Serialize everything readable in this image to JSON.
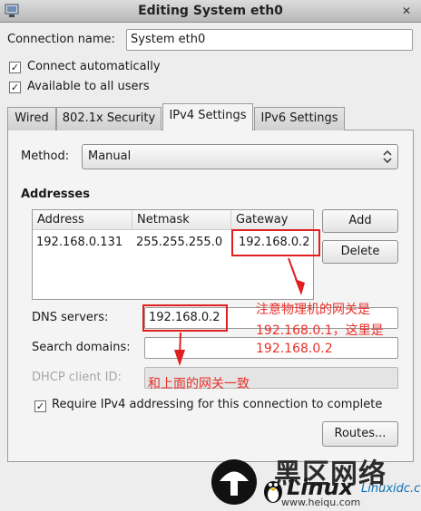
{
  "window": {
    "title": "Editing System eth0",
    "close_glyph": "✕"
  },
  "connection_name": {
    "label": "Connection name:",
    "value": "System eth0"
  },
  "checkboxes": {
    "auto_connect": {
      "label": "Connect automatically",
      "checked": true
    },
    "all_users": {
      "label": "Available to all users",
      "checked": true
    }
  },
  "tabs": [
    {
      "label": "Wired",
      "active": false
    },
    {
      "label": "802.1x Security",
      "active": false
    },
    {
      "label": "IPv4 Settings",
      "active": true
    },
    {
      "label": "IPv6 Settings",
      "active": false
    }
  ],
  "ipv4": {
    "method_label": "Method:",
    "method_value": "Manual",
    "addresses_heading": "Addresses",
    "columns": [
      "Address",
      "Netmask",
      "Gateway"
    ],
    "rows": [
      {
        "address": "192.168.0.131",
        "netmask": "255.255.255.0",
        "gateway": "192.168.0.2"
      }
    ],
    "add_button": "Add",
    "delete_button": "Delete",
    "dns_label": "DNS servers:",
    "dns_value": "192.168.0.2",
    "search_label": "Search domains:",
    "search_value": "",
    "dhcp_label": "DHCP client ID:",
    "dhcp_value": "",
    "require_label": "Require IPv4 addressing for this connection to complete",
    "require_checked": true,
    "routes_button": "Routes..."
  },
  "annotations": {
    "note_line1": "注意物理机的网关是",
    "note_line2": "192.168.0.1，这里是",
    "note_line3": "192.168.0.2",
    "note_bottom": "和上面的网关一致",
    "color": "#e8302a"
  },
  "watermark": {
    "cn": "黑区网络",
    "en": "Linux",
    "url": "www.heiqu.com",
    "site": "Linuxidc.com"
  }
}
